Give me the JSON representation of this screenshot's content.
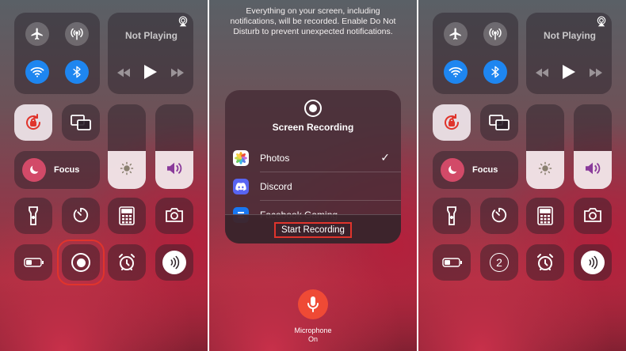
{
  "panels": [
    {
      "now_playing": {
        "title": "Not Playing"
      },
      "focus": {
        "label": "Focus"
      },
      "highlight_record_tile": true,
      "record_tile_glyph": "record-icon",
      "slider_levels": {
        "brightness": 0.45,
        "volume": 0.45
      }
    },
    {
      "notice": "Everything on your screen, including notifications, will be recorded. Enable Do Not Disturb to prevent unexpected notifications.",
      "sheet": {
        "title": "Screen Recording",
        "apps": [
          {
            "name": "Photos",
            "icon": "photos-icon",
            "selected": true
          },
          {
            "name": "Discord",
            "icon": "discord-icon",
            "selected": false
          },
          {
            "name": "Facebook Gaming",
            "icon": "facebook-gaming-icon",
            "selected": false
          }
        ],
        "start_label": "Start Recording",
        "check_glyph": "✓"
      },
      "microphone": {
        "label": "Microphone",
        "state": "On"
      }
    },
    {
      "now_playing": {
        "title": "Not Playing"
      },
      "focus": {
        "label": "Focus"
      },
      "countdown": "2",
      "slider_levels": {
        "brightness": 0.45,
        "volume": 0.45
      }
    }
  ],
  "colors": {
    "accent_blue": "#1e86f0",
    "highlight_red": "#e0342c",
    "mic_red": "#ef4a35"
  }
}
